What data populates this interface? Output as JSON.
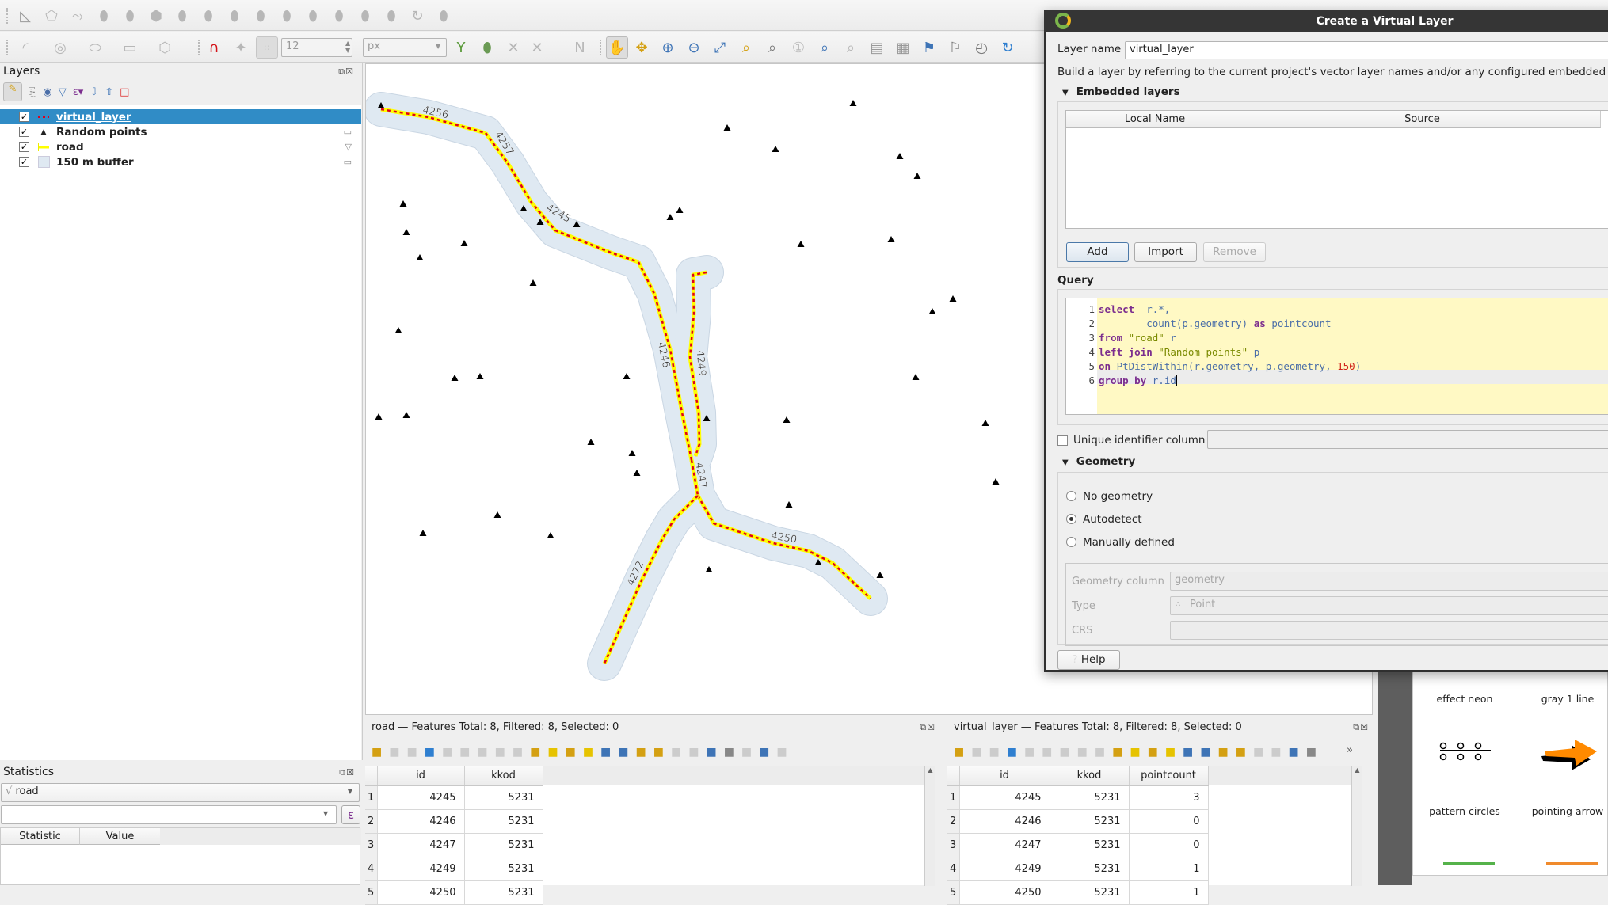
{
  "toolbar": {
    "row1_icons": [
      "measure-icon",
      "add-polygon-icon",
      "vertex-tool-icon",
      "add-ring-icon",
      "add-part-icon",
      "fill-ring-icon",
      "delete-ring-icon",
      "delete-part-icon",
      "reshape-icon",
      "offset-curve-icon",
      "reverse-line-icon",
      "split-features-icon",
      "split-parts-icon",
      "merge-features-icon",
      "merge-attributes-icon",
      "rotate-point-icon",
      "simplify-icon"
    ],
    "row2_icons": [
      "digitize-curve-icon",
      "digitize-circle-icon",
      "digitize-ellipse-icon",
      "digitize-rectangle-icon",
      "digitize-regular-polygon-icon"
    ],
    "snapping_icon": "magnet-icon",
    "tolerance_value": "12",
    "tolerance_unit": "px",
    "nav_icons": [
      "pan-icon",
      "pan-to-selection-icon",
      "zoom-in-icon",
      "zoom-out-icon",
      "zoom-full-icon",
      "zoom-to-selection-icon",
      "zoom-to-layer-icon",
      "zoom-native-icon",
      "zoom-last-icon",
      "zoom-next-icon",
      "new-map-view-icon",
      "new-3d-view-icon",
      "new-bookmark-icon",
      "show-bookmarks-icon",
      "temporal-controller-icon",
      "refresh-icon"
    ]
  },
  "layers_panel": {
    "title": "Layers",
    "layers": [
      {
        "name": "virtual_layer",
        "checked": true,
        "selected": true,
        "symbol": "red-dash-line"
      },
      {
        "name": "Random points",
        "checked": true,
        "selected": false,
        "symbol": "triangle-marker"
      },
      {
        "name": "road",
        "checked": true,
        "selected": false,
        "symbol": "yellow-line"
      },
      {
        "name": "150 m buffer",
        "checked": true,
        "selected": false,
        "symbol": "light-blue-fill"
      }
    ]
  },
  "statistics_panel": {
    "title": "Statistics",
    "layer": "road",
    "field": "",
    "columns": [
      "Statistic",
      "Value"
    ]
  },
  "map": {
    "road_labels": [
      "4256",
      "4257",
      "4245",
      "4246",
      "4249",
      "4247",
      "4250",
      "4272"
    ],
    "colors": {
      "road": "#ffff00",
      "virtual": "#e0001a",
      "buffer": "#dfe9f2",
      "points": "#000000"
    }
  },
  "attr_table_road": {
    "title": "road — Features Total: 8, Filtered: 8, Selected: 0",
    "columns": [
      "id",
      "kkod"
    ],
    "rows": [
      [
        "1",
        "4245",
        "5231"
      ],
      [
        "2",
        "4246",
        "5231"
      ],
      [
        "3",
        "4247",
        "5231"
      ],
      [
        "4",
        "4249",
        "5231"
      ],
      [
        "5",
        "4250",
        "5231"
      ]
    ]
  },
  "attr_table_virtual": {
    "title": "virtual_layer — Features Total: 8, Filtered: 8, Selected: 0",
    "columns": [
      "id",
      "kkod",
      "pointcount"
    ],
    "rows": [
      [
        "1",
        "4245",
        "5231",
        "3"
      ],
      [
        "2",
        "4246",
        "5231",
        "0"
      ],
      [
        "3",
        "4247",
        "5231",
        "0"
      ],
      [
        "4",
        "4249",
        "5231",
        "1"
      ],
      [
        "5",
        "4250",
        "5231",
        "1"
      ]
    ]
  },
  "style_panel": {
    "items": [
      "effect neon",
      "gray 1 line",
      "pattern circles",
      "pointing arrow"
    ]
  },
  "dialog": {
    "title": "Create a Virtual Layer",
    "layer_name_label": "Layer name",
    "layer_name_value": "virtual_layer",
    "description": "Build a layer by referring to the current project's vector layer names and/or any configured embedded layers",
    "embedded_section": "Embedded layers",
    "embedded_columns": [
      "Local Name",
      "Source"
    ],
    "add_button": "Add",
    "import_button": "Import",
    "remove_button": "Remove",
    "query_section": "Query",
    "query_lines": [
      "select  r.*,",
      "        count(p.geometry) as pointcount",
      "from \"road\" r",
      "left join \"Random points\" p",
      "on PtDistWithin(r.geometry, p.geometry, 150)",
      "group by r.id"
    ],
    "unique_id_label": "Unique identifier column",
    "unique_id_checked": false,
    "geometry_section": "Geometry",
    "geometry_options": [
      "No geometry",
      "Autodetect",
      "Manually defined"
    ],
    "geometry_selected": "Autodetect",
    "geometry_column_label": "Geometry column",
    "geometry_column_value": "geometry",
    "type_label": "Type",
    "type_value": "Point",
    "crs_label": "CRS",
    "crs_value": "",
    "help_button": "Help"
  }
}
